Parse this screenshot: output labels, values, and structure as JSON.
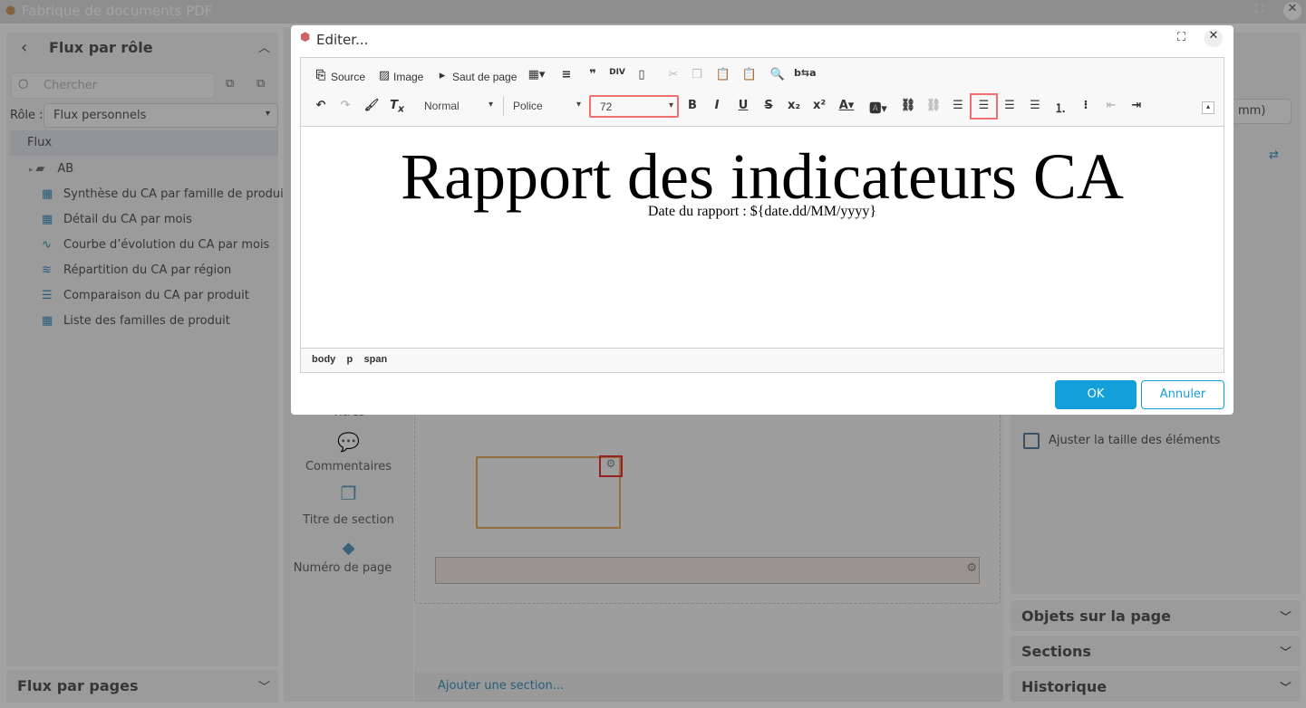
{
  "app": {
    "title": "Fabrique de documents PDF"
  },
  "left_panel": {
    "title": "Flux par rôle",
    "search_placeholder": "Chercher",
    "role_label": "Rôle :",
    "role_value": "Flux personnels",
    "tree": {
      "root": "Flux",
      "folder": "AB",
      "items": [
        {
          "label": "Synthèse du CA par famille de produit",
          "icon": "grid-icon"
        },
        {
          "label": "Détail du CA par mois",
          "icon": "grid-icon"
        },
        {
          "label": "Courbe d’évolution du CA par mois",
          "icon": "line-chart-icon"
        },
        {
          "label": "Répartition du CA par région",
          "icon": "map-icon"
        },
        {
          "label": "Comparaison du CA par produit",
          "icon": "bar-chart-icon"
        },
        {
          "label": "Liste des familles de produit",
          "icon": "table-icon"
        }
      ]
    },
    "bottom_title": "Flux par pages"
  },
  "tools": {
    "items": [
      "Titres",
      "Commentaires",
      "Titre de section",
      "Numéro de page"
    ]
  },
  "canvas": {
    "add_section": "Ajouter une section..."
  },
  "right_panel": {
    "unit_suffix": "mm)",
    "checkbox_label": "Ajuster la taille des éléments",
    "sections": [
      "Objets sur la page",
      "Sections",
      "Historique"
    ]
  },
  "dialog": {
    "title": "Editer...",
    "toolbar": {
      "source": "Source",
      "image": "Image",
      "page_break": "Saut de page",
      "format": "Normal",
      "font": "Police",
      "size": "72"
    },
    "content": {
      "heading": "Rapport des indicateurs CA",
      "subtitle": "Date du rapport : ${date.dd/MM/yyyy}"
    },
    "path": [
      "body",
      "p",
      "span"
    ],
    "ok": "OK",
    "cancel": "Annuler"
  },
  "colors": {
    "accent": "#139fd8",
    "highlight": "#f07070"
  }
}
